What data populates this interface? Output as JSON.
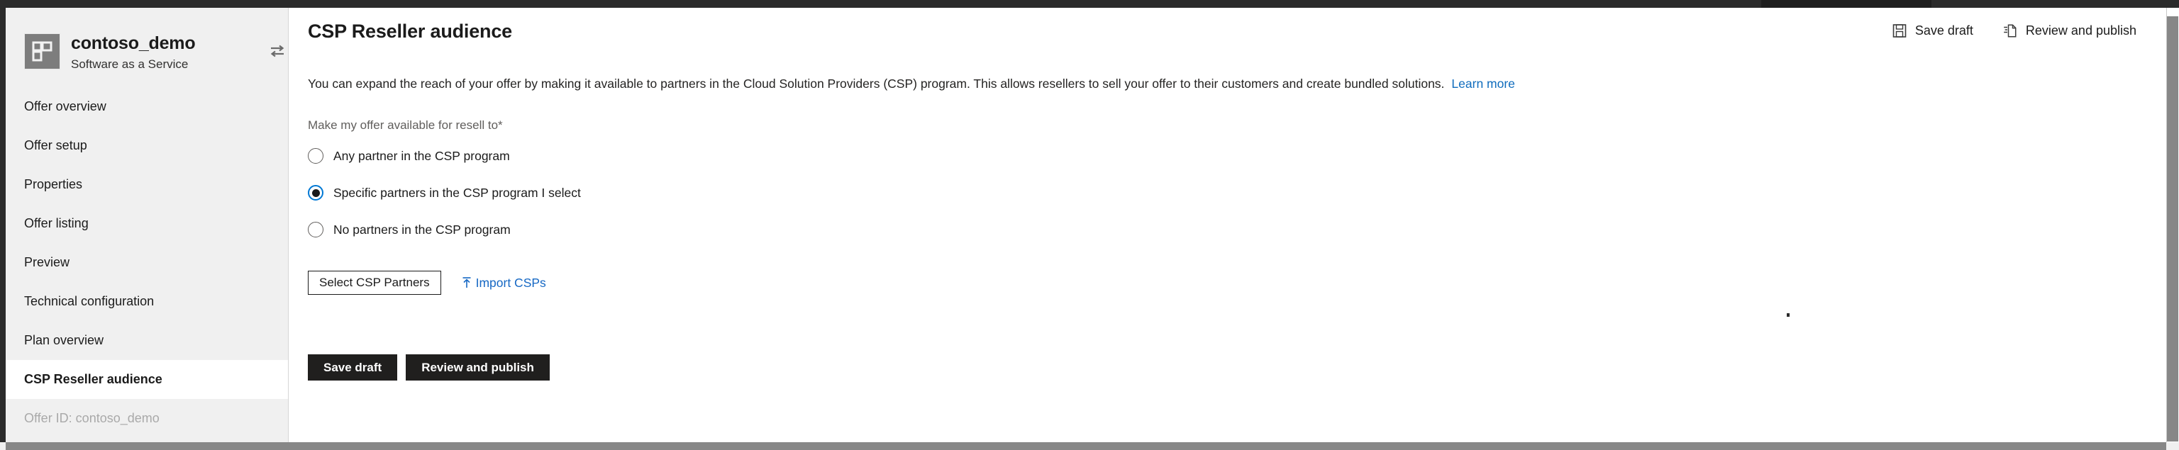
{
  "window": {
    "accent_blue": "#0078d4",
    "link_blue": "#1668c4",
    "dark_button": "#201f1e",
    "sidebar_bg": "#f0f0f0"
  },
  "sidebar": {
    "offer": {
      "name": "contoso_demo",
      "type": "Software as a Service",
      "icon": "offer-tile-icon",
      "swap_icon": "swap-offer-icon"
    },
    "items": [
      {
        "label": "Offer overview",
        "selected": false,
        "muted": false
      },
      {
        "label": "Offer setup",
        "selected": false,
        "muted": false
      },
      {
        "label": "Properties",
        "selected": false,
        "muted": false
      },
      {
        "label": "Offer listing",
        "selected": false,
        "muted": false
      },
      {
        "label": "Preview",
        "selected": false,
        "muted": false
      },
      {
        "label": "Technical configuration",
        "selected": false,
        "muted": false
      },
      {
        "label": "Plan overview",
        "selected": false,
        "muted": false
      },
      {
        "label": "CSP Reseller audience",
        "selected": true,
        "muted": false
      },
      {
        "label": "Offer ID: contoso_demo",
        "selected": false,
        "muted": true
      }
    ]
  },
  "main": {
    "page_title": "CSP Reseller audience",
    "commands": {
      "save_draft": {
        "label": "Save draft",
        "icon": "save-icon"
      },
      "review_publish": {
        "label": "Review and publish",
        "icon": "publish-document-icon"
      }
    },
    "description": {
      "text": "You can expand the reach of your offer by making it available to partners in the Cloud Solution Providers (CSP) program. This allows resellers to sell your offer to their customers and create bundled solutions.",
      "link_label": "Learn more"
    },
    "field_label": "Make my offer available for resell to*",
    "radio_options": [
      {
        "label": "Any partner in the CSP program",
        "checked": false
      },
      {
        "label": "Specific partners in the CSP program I select",
        "checked": true
      },
      {
        "label": "No partners in the CSP program",
        "checked": false
      }
    ],
    "select_partners_button": "Select CSP Partners",
    "import_link": {
      "label": "Import CSPs",
      "icon": "upload-arrow-icon"
    },
    "footer_actions": {
      "save_draft": "Save draft",
      "review_publish": "Review and publish"
    }
  }
}
